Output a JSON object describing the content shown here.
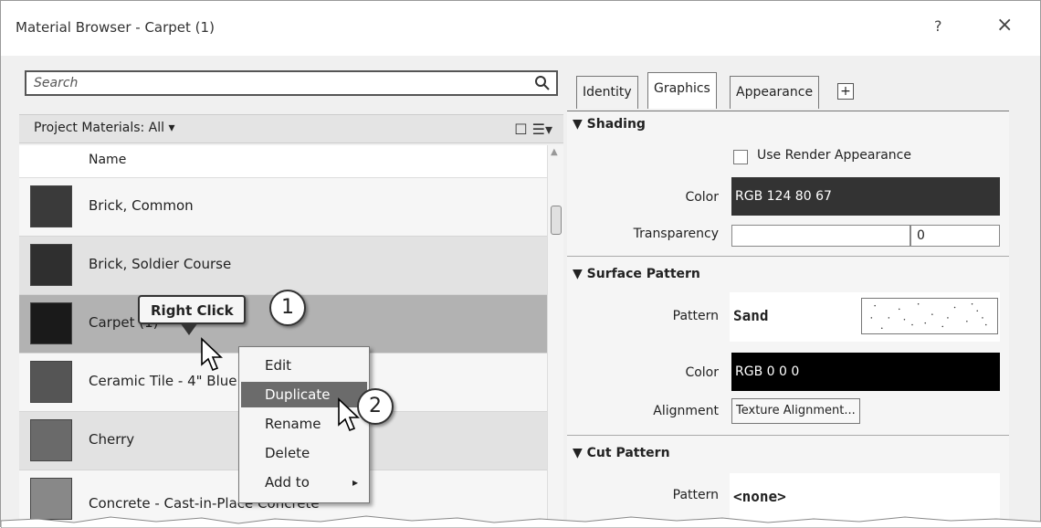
{
  "window": {
    "title": "Material Browser - Carpet (1)",
    "help_label": "?",
    "close_label": "×"
  },
  "search": {
    "placeholder": "Search",
    "icon": "search-icon"
  },
  "project_bar": {
    "label": "Project Materials: All ▾",
    "view_icons": "☐ ☰▾"
  },
  "list": {
    "header": "Name",
    "rows": [
      {
        "label": "Brick, Common",
        "thumb_color": "#3a3a3a"
      },
      {
        "label": "Brick, Soldier Course",
        "thumb_color": "#2f2f2f"
      },
      {
        "label": "Carpet (1)",
        "thumb_color": "#1a1a1a"
      },
      {
        "label": "Ceramic Tile - 4\" Blue",
        "thumb_color": "#555555"
      },
      {
        "label": "Cherry",
        "thumb_color": "#6a6a6a"
      },
      {
        "label": "Concrete - Cast-in-Place Concrete",
        "thumb_color": "#888888"
      }
    ],
    "selected_row": "Carpet (1)"
  },
  "context_menu": {
    "items": [
      {
        "label": "Edit"
      },
      {
        "label": "Duplicate",
        "highlighted": true
      },
      {
        "label": "Rename"
      },
      {
        "label": "Delete"
      },
      {
        "label": "Add to",
        "submenu_arrow": "▸"
      }
    ]
  },
  "annotations": {
    "callout": "Right Click",
    "step1": "1",
    "step2": "2"
  },
  "tabs": {
    "items": [
      {
        "label": "Identity"
      },
      {
        "label": "Graphics",
        "active": true
      },
      {
        "label": "Appearance"
      }
    ],
    "add_label": "+"
  },
  "properties": {
    "shading": {
      "title": "▼ Shading",
      "use_render_label": "Use Render Appearance",
      "color_label": "Color",
      "color_value": "RGB 124 80 67",
      "color_hex": "#333333",
      "transparency_label": "Transparency",
      "transparency_value": "0"
    },
    "surface_pattern": {
      "title": "▼ Surface Pattern",
      "pattern_label": "Pattern",
      "pattern_value": "Sand",
      "color_label": "Color",
      "color_value": "RGB 0 0 0",
      "color_hex": "#000000",
      "alignment_label": "Alignment",
      "alignment_button": "Texture Alignment..."
    },
    "cut_pattern": {
      "title": "▼ Cut Pattern",
      "pattern_label": "Pattern",
      "pattern_value": "<none>"
    }
  }
}
